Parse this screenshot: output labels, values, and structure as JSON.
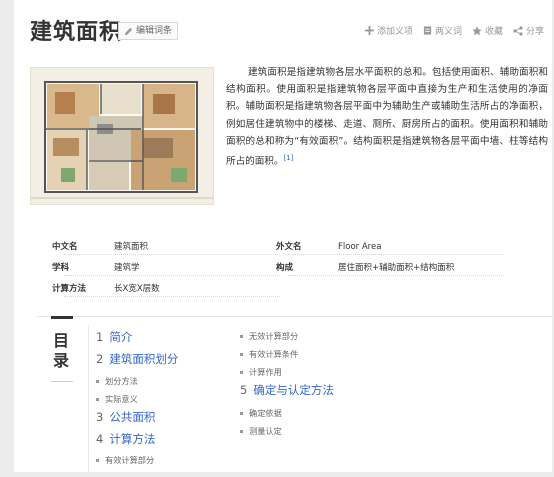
{
  "title": "建筑面积",
  "edit_label": "编辑词条",
  "actions": {
    "add_label": "添加义项",
    "ambiguity_label": "两义词",
    "favorite_label": "收藏",
    "share_label": "分享"
  },
  "image_alt": "floor-plan",
  "summary": {
    "text": "建筑面积是指建筑物各层水平面积的总和。包括使用面积、辅助面积和结构面积。使用面积是指建筑物各层平面中直接为生产和生活使用的净面积。辅助面积是指建筑物各层平面中为辅助生产或辅助生活所占的净面积，例如居住建筑物中的楼梯、走道、厕所、厨房所占的面积。使用面积和辅助面积的总和称为“有效面积”。结构面积是指建筑物各层平面中墙、柱等结构所占的面积。",
    "ref": "[1]"
  },
  "infobox": {
    "left": [
      {
        "key": "中文名",
        "value": "建筑面积"
      },
      {
        "key": "学科",
        "value": "建筑学"
      },
      {
        "key": "计算方法",
        "value": "长X宽X层数"
      }
    ],
    "right": [
      {
        "key": "外文名",
        "value": "Floor Area"
      },
      {
        "key": "构成",
        "value": "居住面积+辅助面积+结构面积"
      }
    ]
  },
  "toc": {
    "heading": "目录",
    "col1": [
      {
        "level": 1,
        "num": "1",
        "label": "简介"
      },
      {
        "level": 1,
        "num": "2",
        "label": "建筑面积划分"
      },
      {
        "level": 2,
        "label": "划分方法"
      },
      {
        "level": 2,
        "label": "实际意义"
      },
      {
        "level": 1,
        "num": "3",
        "label": "公共面积"
      },
      {
        "level": 1,
        "num": "4",
        "label": "计算方法"
      },
      {
        "level": 2,
        "label": "有效计算部分"
      }
    ],
    "col2": [
      {
        "level": 2,
        "label": "无效计算部分"
      },
      {
        "level": 2,
        "label": "有效计算条件"
      },
      {
        "level": 2,
        "label": "计算作用"
      },
      {
        "level": 1,
        "num": "5",
        "label": "确定与认定方法"
      },
      {
        "level": 2,
        "label": "确定依据"
      },
      {
        "level": 2,
        "label": "测量认定"
      }
    ]
  }
}
